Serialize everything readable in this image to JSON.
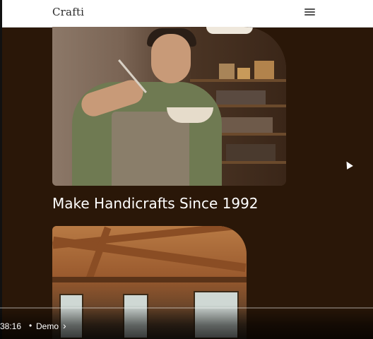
{
  "header": {
    "logo_text": "Crafti",
    "menu_icon": "hamburger-menu-icon"
  },
  "hero": {
    "title": "Make Handicrafts Since 1992"
  },
  "video_controls": {
    "timestamp": "38:16",
    "separator": "•",
    "chapter_label": "Demo",
    "chapter_icon": "chevron-right-icon"
  },
  "colors": {
    "page_background": "#2a1708",
    "header_background": "#ffffff",
    "title_text": "#ffffff"
  }
}
